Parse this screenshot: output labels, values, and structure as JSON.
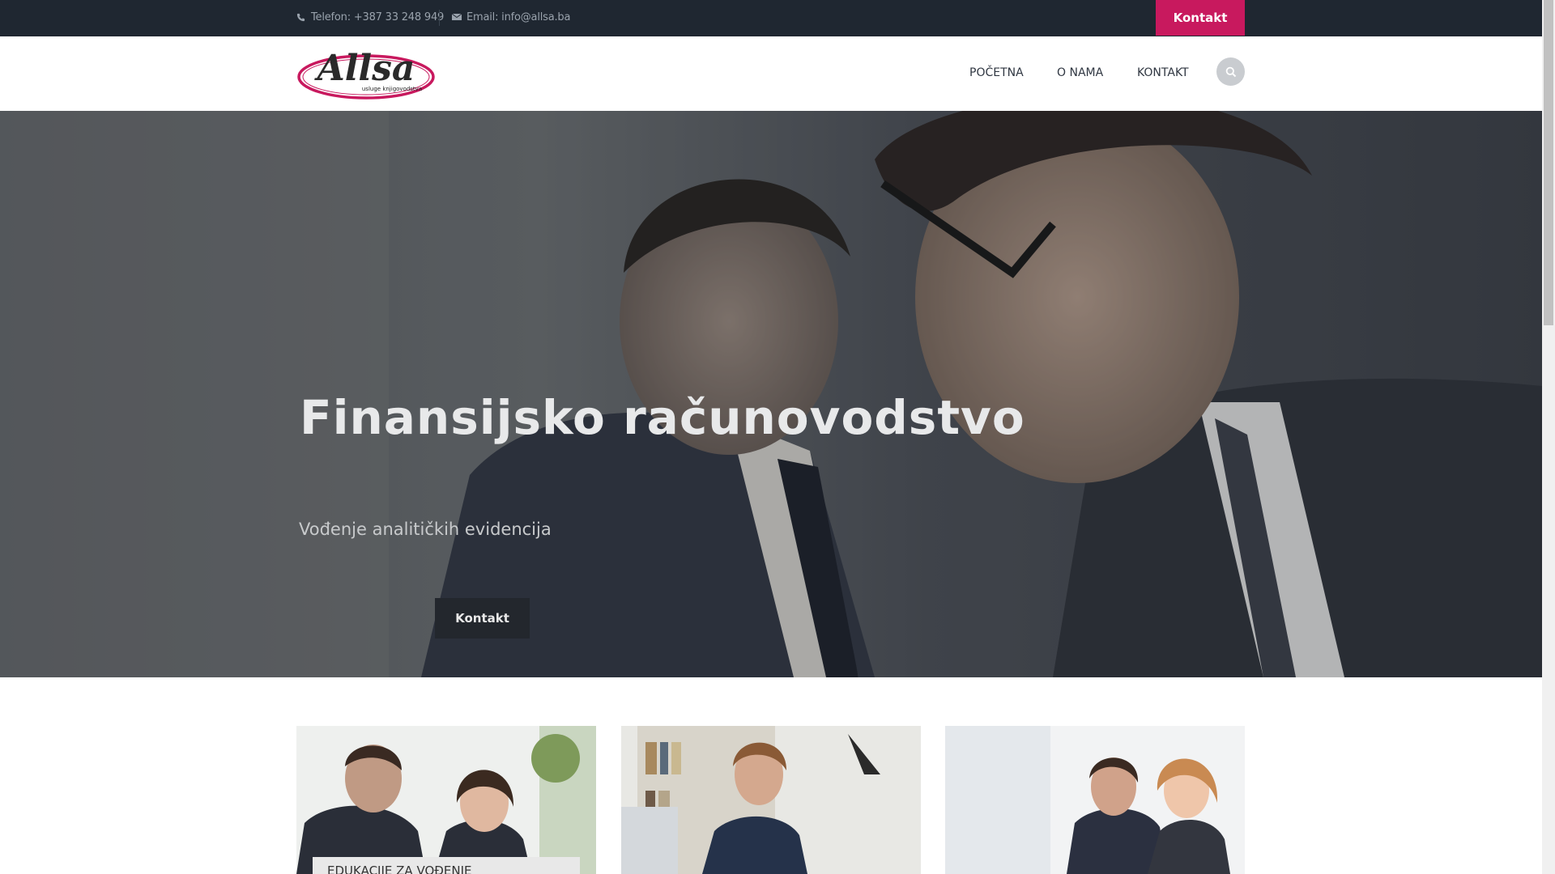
{
  "topbar": {
    "phone_text": "Telefon: +387 33 248 949",
    "email_text": "Email: info@allsa.ba",
    "contact_button": "Kontakt",
    "phone_icon": "phone-icon",
    "email_icon": "envelope-icon"
  },
  "header": {
    "logo_text": "Allsa",
    "logo_tagline": "usluge knjigovodstva",
    "nav": [
      "POČETNA",
      "O NAMA",
      "KONTAKT"
    ],
    "search_icon": "search-icon"
  },
  "hero": {
    "title": "Finansijsko računovodstvo",
    "subtitle": "Vođenje analitičkih evidencija",
    "button": "Kontakt",
    "slide_count": 4,
    "active_slide": 1
  },
  "cards": [
    {
      "label": "EDUKACIJE ZA VOĐENJE"
    },
    {
      "label": ""
    },
    {
      "label": ""
    }
  ],
  "colors": {
    "accent": "#c8195e",
    "topbar": "#1f2731",
    "nav_text": "#303742"
  }
}
